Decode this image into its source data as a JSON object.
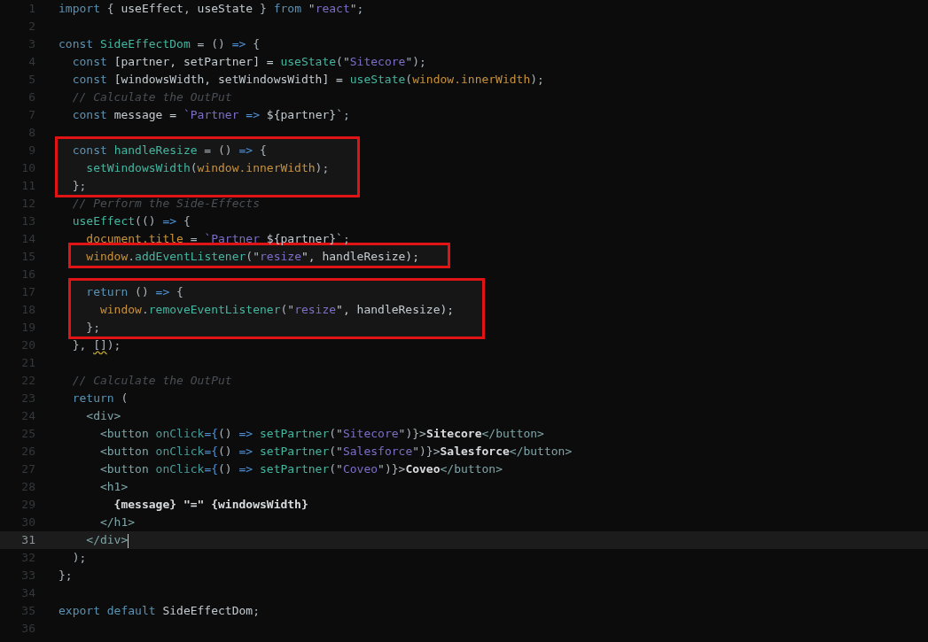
{
  "editor": {
    "lines": [
      {
        "n": "1",
        "boxed": false,
        "current": false,
        "tokens": [
          {
            "text": "import",
            "kind": "kw"
          },
          {
            "text": " { ",
            "kind": "p"
          },
          {
            "text": "useEffect",
            "kind": "v"
          },
          {
            "text": ", ",
            "kind": "p"
          },
          {
            "text": "useState",
            "kind": "v"
          },
          {
            "text": " } ",
            "kind": "p"
          },
          {
            "text": "from",
            "kind": "kw"
          },
          {
            "text": " \"",
            "kind": "p"
          },
          {
            "text": "react",
            "kind": "s"
          },
          {
            "text": "\";",
            "kind": "p"
          }
        ]
      },
      {
        "n": "2",
        "boxed": false,
        "current": false
      },
      {
        "n": "3",
        "boxed": false,
        "current": false,
        "tokens": [
          {
            "text": "const ",
            "kind": "kw"
          },
          {
            "text": "SideEffectDom",
            "kind": "fn"
          },
          {
            "text": " = () ",
            "kind": "p"
          },
          {
            "text": "=>",
            "kind": "op"
          },
          {
            "text": " {",
            "kind": "p"
          }
        ]
      },
      {
        "n": "4",
        "boxed": false,
        "current": false,
        "tokens": [
          {
            "text": "  const ",
            "kind": "kw"
          },
          {
            "text": "[partner, setPartner] = ",
            "kind": "v"
          },
          {
            "text": "useState",
            "kind": "fn"
          },
          {
            "text": "(\"",
            "kind": "p"
          },
          {
            "text": "Sitecore",
            "kind": "s"
          },
          {
            "text": "\");",
            "kind": "p"
          }
        ]
      },
      {
        "n": "5",
        "boxed": false,
        "current": false,
        "tokens": [
          {
            "text": "  const ",
            "kind": "kw"
          },
          {
            "text": "[windowsWidth, setWindowsWidth] = ",
            "kind": "v"
          },
          {
            "text": "useState",
            "kind": "fn"
          },
          {
            "text": "(",
            "kind": "p"
          },
          {
            "text": "window.innerWidth",
            "kind": "g"
          },
          {
            "text": ");",
            "kind": "p"
          }
        ]
      },
      {
        "n": "6",
        "boxed": false,
        "current": false,
        "tokens": [
          {
            "text": "  // Calculate the OutPut",
            "kind": "c"
          }
        ]
      },
      {
        "n": "7",
        "boxed": false,
        "current": false,
        "tokens": [
          {
            "text": "  const ",
            "kind": "kw"
          },
          {
            "text": "message = ",
            "kind": "v"
          },
          {
            "text": "`Partner ",
            "kind": "s"
          },
          {
            "text": "=> ",
            "kind": "op"
          },
          {
            "text": "${partner}",
            "kind": "v"
          },
          {
            "text": "`;",
            "kind": "p"
          }
        ]
      },
      {
        "n": "8",
        "boxed": false,
        "current": false
      },
      {
        "n": "9",
        "boxed": true,
        "current": false,
        "tokens": [
          {
            "text": "  const ",
            "kind": "kw"
          },
          {
            "text": "handleResize",
            "kind": "fn"
          },
          {
            "text": " = () ",
            "kind": "p"
          },
          {
            "text": "=>",
            "kind": "op"
          },
          {
            "text": " {",
            "kind": "p"
          }
        ]
      },
      {
        "n": "10",
        "boxed": true,
        "current": false,
        "tokens": [
          {
            "text": "    setWindowsWidth",
            "kind": "fn"
          },
          {
            "text": "(",
            "kind": "p"
          },
          {
            "text": "window.innerWidth",
            "kind": "g"
          },
          {
            "text": ");",
            "kind": "p"
          }
        ]
      },
      {
        "n": "11",
        "boxed": true,
        "current": false,
        "tokens": [
          {
            "text": "  };",
            "kind": "p"
          }
        ]
      },
      {
        "n": "12",
        "boxed": false,
        "current": false,
        "tokens": [
          {
            "text": "  // Perform the Side-Effects",
            "kind": "c"
          }
        ]
      },
      {
        "n": "13",
        "boxed": false,
        "current": false,
        "tokens": [
          {
            "text": "  useEffect",
            "kind": "fn"
          },
          {
            "text": "(() ",
            "kind": "p"
          },
          {
            "text": "=>",
            "kind": "op"
          },
          {
            "text": " {",
            "kind": "p"
          }
        ]
      },
      {
        "n": "14",
        "boxed": false,
        "current": false,
        "tokens": [
          {
            "text": "    document.title",
            "kind": "g"
          },
          {
            "text": " = ",
            "kind": "p"
          },
          {
            "text": "`Partner ",
            "kind": "s"
          },
          {
            "text": "${partner}",
            "kind": "v"
          },
          {
            "text": "`;",
            "kind": "p"
          }
        ]
      },
      {
        "n": "15",
        "boxed": true,
        "current": false,
        "tokens": [
          {
            "text": "    window",
            "kind": "g"
          },
          {
            "text": ".",
            "kind": "p"
          },
          {
            "text": "addEventListener",
            "kind": "fn"
          },
          {
            "text": "(\"",
            "kind": "p"
          },
          {
            "text": "resize",
            "kind": "s"
          },
          {
            "text": "\", handleResize);",
            "kind": "v"
          }
        ]
      },
      {
        "n": "16",
        "boxed": false,
        "current": false
      },
      {
        "n": "17",
        "boxed": true,
        "current": false,
        "tokens": [
          {
            "text": "    return",
            "kind": "kw"
          },
          {
            "text": " () ",
            "kind": "p"
          },
          {
            "text": "=>",
            "kind": "op"
          },
          {
            "text": " {",
            "kind": "p"
          }
        ]
      },
      {
        "n": "18",
        "boxed": true,
        "current": false,
        "tokens": [
          {
            "text": "      window",
            "kind": "g"
          },
          {
            "text": ".",
            "kind": "p"
          },
          {
            "text": "removeEventListener",
            "kind": "fn"
          },
          {
            "text": "(\"",
            "kind": "p"
          },
          {
            "text": "resize",
            "kind": "s"
          },
          {
            "text": "\", handleResize);",
            "kind": "v"
          }
        ]
      },
      {
        "n": "19",
        "boxed": true,
        "current": false,
        "tokens": [
          {
            "text": "    };",
            "kind": "p"
          }
        ]
      },
      {
        "n": "20",
        "boxed": false,
        "current": false,
        "tokens": [
          {
            "text": "  }, ",
            "kind": "p"
          },
          {
            "text": "[]",
            "kind": "warn"
          },
          {
            "text": ");",
            "kind": "p"
          }
        ]
      },
      {
        "n": "21",
        "boxed": false,
        "current": false
      },
      {
        "n": "22",
        "boxed": false,
        "current": false,
        "tokens": [
          {
            "text": "  // Calculate the OutPut",
            "kind": "c"
          }
        ]
      },
      {
        "n": "23",
        "boxed": false,
        "current": false,
        "tokens": [
          {
            "text": "  return",
            "kind": "kw"
          },
          {
            "text": " (",
            "kind": "p"
          }
        ]
      },
      {
        "n": "24",
        "boxed": false,
        "current": false,
        "tokens": [
          {
            "text": "    <div>",
            "kind": "tag"
          }
        ]
      },
      {
        "n": "25",
        "boxed": false,
        "current": false,
        "tokens": [
          {
            "text": "      <button ",
            "kind": "tag"
          },
          {
            "text": "onClick",
            "kind": "attr"
          },
          {
            "text": "={",
            "kind": "op"
          },
          {
            "text": "() ",
            "kind": "p"
          },
          {
            "text": "=> ",
            "kind": "op"
          },
          {
            "text": "setPartner",
            "kind": "fn"
          },
          {
            "text": "(\"",
            "kind": "p"
          },
          {
            "text": "Sitecore",
            "kind": "s"
          },
          {
            "text": "\")}>",
            "kind": "p"
          },
          {
            "text": "Sitecore",
            "kind": "t"
          },
          {
            "text": "</button>",
            "kind": "tag"
          }
        ]
      },
      {
        "n": "26",
        "boxed": false,
        "current": false,
        "tokens": [
          {
            "text": "      <button ",
            "kind": "tag"
          },
          {
            "text": "onClick",
            "kind": "attr"
          },
          {
            "text": "={",
            "kind": "op"
          },
          {
            "text": "() ",
            "kind": "p"
          },
          {
            "text": "=> ",
            "kind": "op"
          },
          {
            "text": "setPartner",
            "kind": "fn"
          },
          {
            "text": "(\"",
            "kind": "p"
          },
          {
            "text": "Salesforce",
            "kind": "s"
          },
          {
            "text": "\")}>",
            "kind": "p"
          },
          {
            "text": "Salesforce",
            "kind": "t"
          },
          {
            "text": "</button>",
            "kind": "tag"
          }
        ]
      },
      {
        "n": "27",
        "boxed": false,
        "current": false,
        "tokens": [
          {
            "text": "      <button ",
            "kind": "tag"
          },
          {
            "text": "onClick",
            "kind": "attr"
          },
          {
            "text": "={",
            "kind": "op"
          },
          {
            "text": "() ",
            "kind": "p"
          },
          {
            "text": "=> ",
            "kind": "op"
          },
          {
            "text": "setPartner",
            "kind": "fn"
          },
          {
            "text": "(\"",
            "kind": "p"
          },
          {
            "text": "Coveo",
            "kind": "s"
          },
          {
            "text": "\")}>",
            "kind": "p"
          },
          {
            "text": "Coveo",
            "kind": "t"
          },
          {
            "text": "</button>",
            "kind": "tag"
          }
        ]
      },
      {
        "n": "28",
        "boxed": false,
        "current": false,
        "tokens": [
          {
            "text": "      <h1>",
            "kind": "tag"
          }
        ]
      },
      {
        "n": "29",
        "boxed": false,
        "current": false,
        "tokens": [
          {
            "text": "        {message} \"=\" {windowsWidth}",
            "kind": "t"
          }
        ]
      },
      {
        "n": "30",
        "boxed": false,
        "current": false,
        "tokens": [
          {
            "text": "      </h1>",
            "kind": "tag"
          }
        ]
      },
      {
        "n": "31",
        "boxed": false,
        "current": true,
        "tokens": [
          {
            "text": "    </div>",
            "kind": "tag"
          }
        ]
      },
      {
        "n": "32",
        "boxed": false,
        "current": false,
        "tokens": [
          {
            "text": "  );",
            "kind": "p"
          }
        ]
      },
      {
        "n": "33",
        "boxed": false,
        "current": false,
        "tokens": [
          {
            "text": "};",
            "kind": "p"
          }
        ]
      },
      {
        "n": "34",
        "boxed": false,
        "current": false
      },
      {
        "n": "35",
        "boxed": false,
        "current": false,
        "tokens": [
          {
            "text": "export default ",
            "kind": "kw"
          },
          {
            "text": "SideEffectDom",
            "kind": "v"
          },
          {
            "text": ";",
            "kind": "p"
          }
        ]
      },
      {
        "n": "36",
        "boxed": false,
        "current": false
      }
    ]
  }
}
